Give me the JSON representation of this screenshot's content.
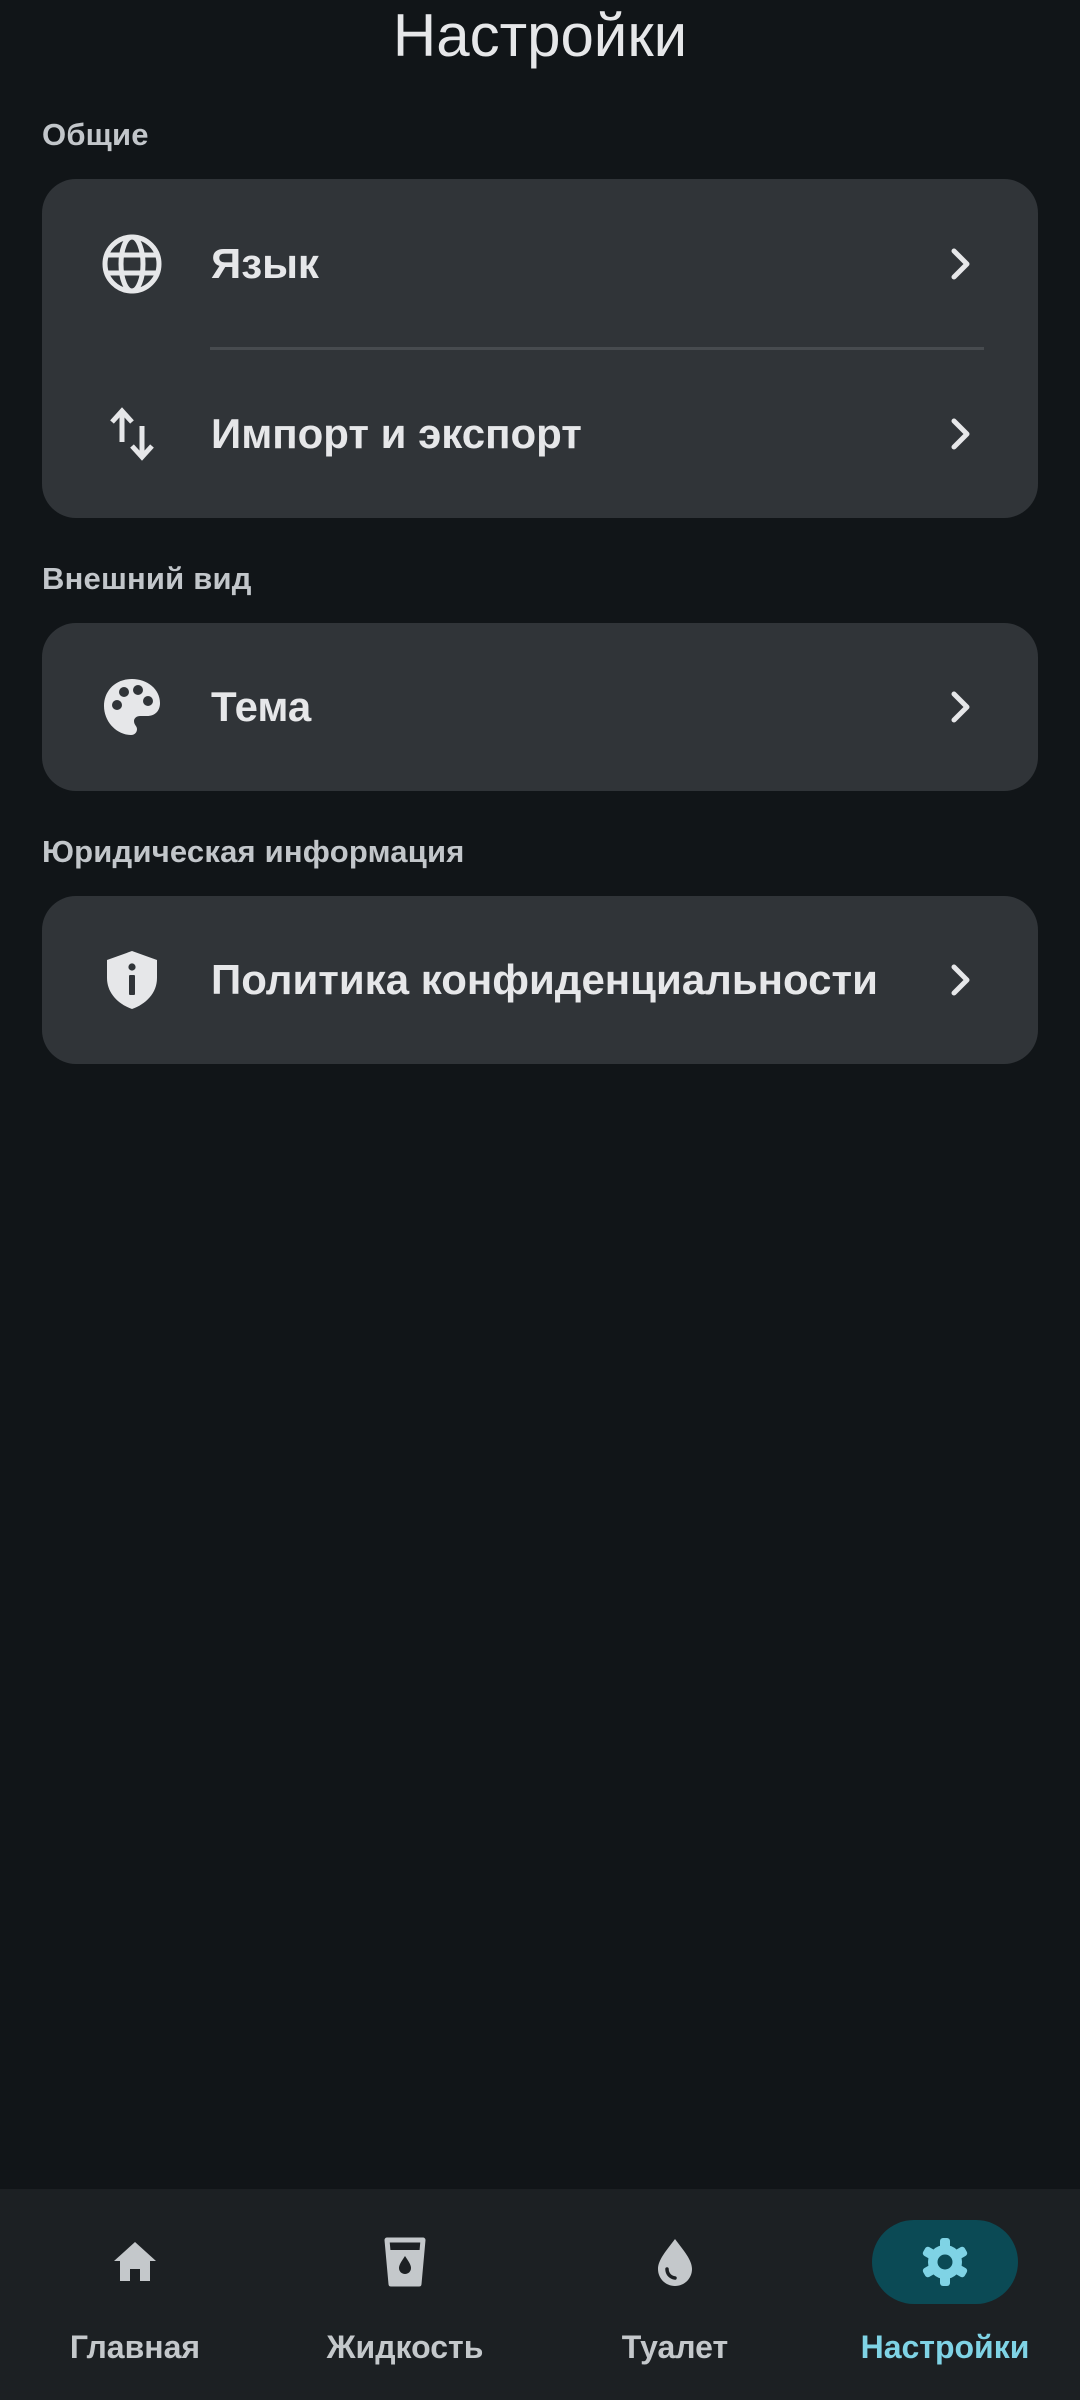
{
  "header": {
    "title": "Настройки"
  },
  "sections": {
    "general": {
      "title": "Общие",
      "items": [
        {
          "label": "Язык",
          "icon": "globe-icon"
        },
        {
          "label": "Импорт и экспорт",
          "icon": "import-export-icon"
        }
      ]
    },
    "appearance": {
      "title": "Внешний вид",
      "items": [
        {
          "label": "Тема",
          "icon": "palette-icon"
        }
      ]
    },
    "legal": {
      "title": "Юридическая информация",
      "items": [
        {
          "label": "Политика конфиденциальности",
          "icon": "shield-info-icon"
        }
      ]
    }
  },
  "bottom_nav": {
    "items": [
      {
        "label": "Главная",
        "icon": "home-icon",
        "active": false
      },
      {
        "label": "Жидкость",
        "icon": "cup-icon",
        "active": false
      },
      {
        "label": "Туалет",
        "icon": "drop-icon",
        "active": false
      },
      {
        "label": "Настройки",
        "icon": "gear-icon",
        "active": true
      }
    ]
  },
  "colors": {
    "background": "#111518",
    "card": "#303438",
    "nav_background": "#1c2023",
    "accent": "#7fd3e5",
    "accent_pill": "#0b4a55"
  }
}
